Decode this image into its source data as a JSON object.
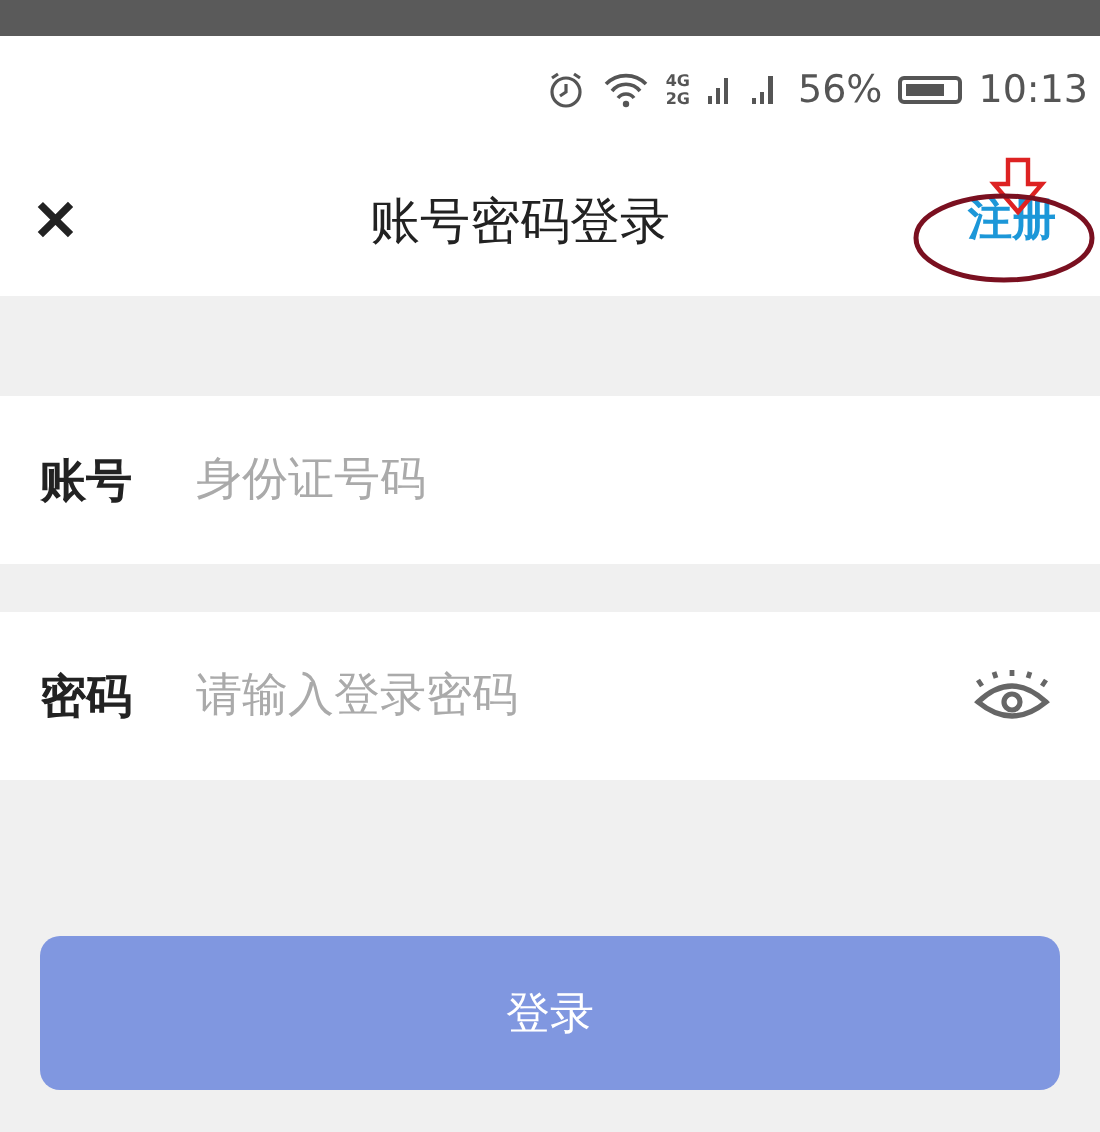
{
  "status_bar": {
    "network_top": "4G",
    "network_bottom": "2G",
    "battery": "56%",
    "time": "10:13"
  },
  "header": {
    "close": "✕",
    "title": "账号密码登录",
    "register": "注册"
  },
  "fields": [
    {
      "kind": "text",
      "label": "账号",
      "placeholder": "身份证号码"
    },
    {
      "kind": "password",
      "label": "密码",
      "placeholder": "请输入登录密码"
    }
  ],
  "login_button": {
    "label": "登录"
  }
}
